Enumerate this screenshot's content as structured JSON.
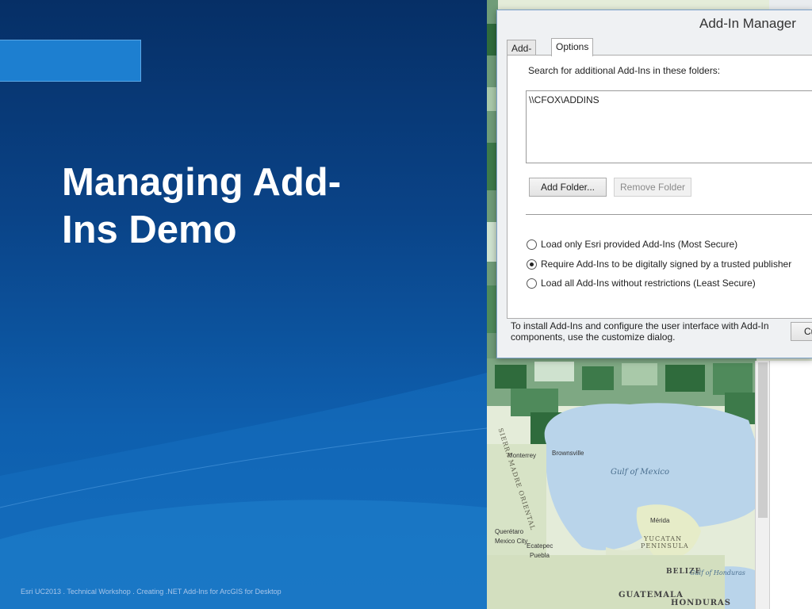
{
  "slide": {
    "title": "Managing Add-\nIns Demo",
    "footer": "Esri UC2013 . Technical Workshop . Creating .NET Add-Ins for ArcGIS for Desktop"
  },
  "dialog": {
    "title": "Add-In Manager",
    "tabs": [
      {
        "label": "Add-Ins",
        "active": false
      },
      {
        "label": "Options",
        "active": true
      }
    ],
    "search_label": "Search for additional Add-Ins in these folders:",
    "folders": [
      "\\\\CFOX\\ADDINS"
    ],
    "add_folder_button": "Add Folder...",
    "remove_folder_button": "Remove Folder",
    "security_options": [
      {
        "label": "Load only Esri provided Add-Ins (Most Secure)",
        "selected": false
      },
      {
        "label": "Require Add-Ins to be digitally signed by a trusted publisher",
        "selected": true
      },
      {
        "label": "Load all Add-Ins without restrictions (Least Secure)",
        "selected": false
      }
    ],
    "footer_note": "To install Add-Ins and configure the user interface with Add-In components, use the customize dialog.",
    "customize_button": "Cu"
  },
  "map_labels": {
    "gulf": "Gulf of Mexico",
    "monterrey": "Monterrey",
    "brownsville": "Brownsville",
    "merida": "Mérida",
    "yucatan": "YUCATAN",
    "peninsula": "PENINSULA",
    "queretaro": "Querétaro",
    "mexico_city": "Mexico City",
    "ecatepec": "Ecatepec",
    "puebla": "Puebla",
    "belize": "BELIZE",
    "gulf_honduras": "Gulf of Honduras",
    "guatemala": "GUATEMALA",
    "honduras": "HONDURAS",
    "sierra_madre": "SIERRA MADRE ORIENTAL"
  },
  "colors": {
    "slide_dark": "#062f66",
    "slide_light": "#126ab9",
    "accent": "#1d7fd0",
    "water": "#b9d4ea",
    "choropleth_dark": "#2f6b3c",
    "choropleth_light": "#cfe2cf"
  }
}
